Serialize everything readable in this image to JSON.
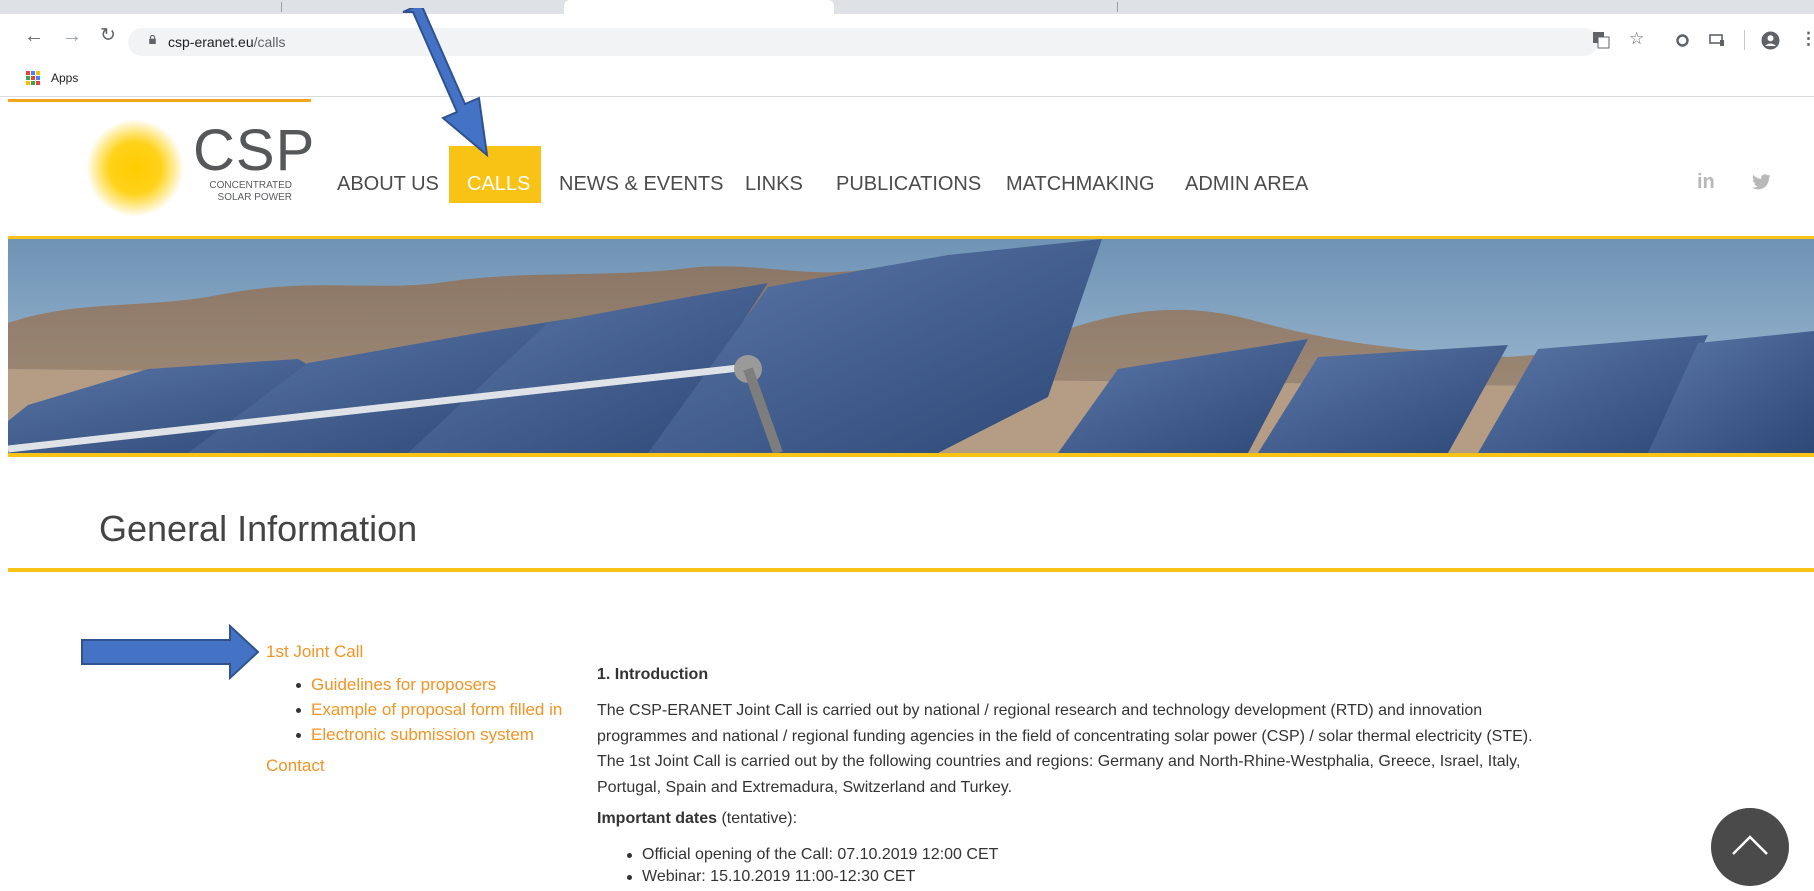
{
  "browser": {
    "url_host": "csp-eranet.eu",
    "url_path": "/calls",
    "bookmarks_bar": {
      "apps_label": "Apps"
    }
  },
  "site": {
    "logo": {
      "main": "CSP",
      "sub_line1": "CONCENTRATED",
      "sub_line2": "SOLAR POWER"
    },
    "nav": {
      "about": "ABOUT US",
      "calls": "CALLS",
      "news": "NEWS & EVENTS",
      "links": "LINKS",
      "publications": "PUBLICATIONS",
      "matchmaking": "MATCHMAKING",
      "admin": "ADMIN AREA"
    },
    "social": {
      "linkedin": "in",
      "twitter_icon": "twitter-bird-icon"
    },
    "accent_color": "#f9c315",
    "link_color": "#f39424"
  },
  "page": {
    "title": "General Information",
    "sidebar": {
      "joint_call": "1st Joint Call",
      "items": [
        {
          "label": "Guidelines for proposers"
        },
        {
          "label": "Example of proposal form filled in"
        },
        {
          "label": "Electronic submission system"
        }
      ],
      "contact": "Contact"
    },
    "main": {
      "heading": "1. Introduction",
      "paragraph": "The CSP-ERANET Joint Call is carried out by national / regional research and technology development (RTD) and innovation programmes and national / regional funding agencies in the field of concentrating solar power (CSP) / solar thermal electricity (STE). The 1st Joint Call is carried out by the following countries and regions:  Germany and North-Rhine-Westphalia, Greece, Israel, Italy, Portugal, Spain and Extremadura, Switzerland and Turkey.",
      "important_label": "Important dates",
      "important_suffix": " (tentative):",
      "dates": [
        {
          "text": "Official opening of the Call: 07.10.2019 12:00 CET"
        },
        {
          "text": "Webinar: 15.10.2019 11:00-12:30 CET"
        }
      ]
    }
  }
}
